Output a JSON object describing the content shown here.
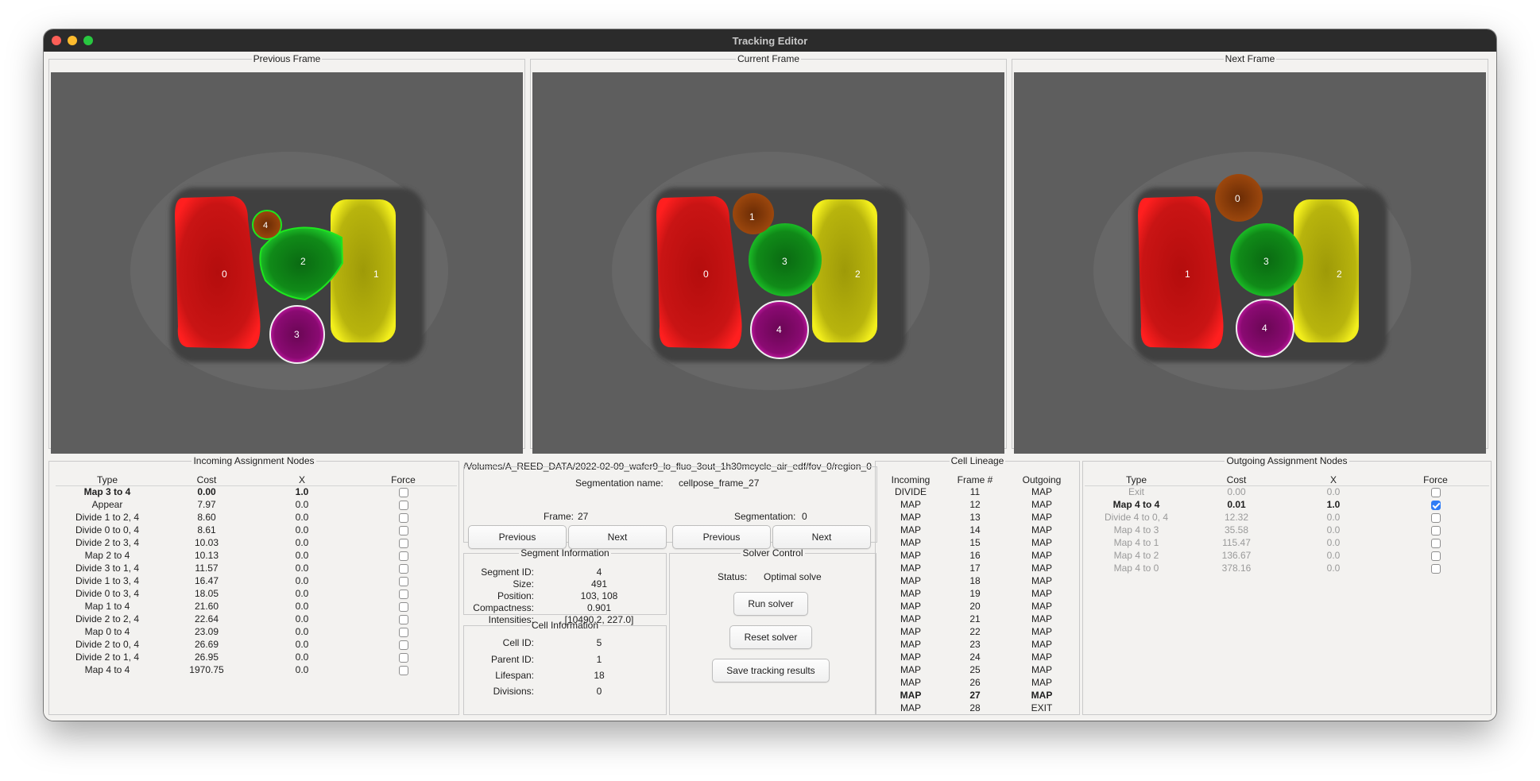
{
  "window": {
    "title": "Tracking Editor"
  },
  "frames": {
    "previous": {
      "title": "Previous Frame",
      "labels": [
        "0",
        "1",
        "2",
        "3",
        "4"
      ]
    },
    "current": {
      "title": "Current Frame",
      "labels": [
        "0",
        "1",
        "2",
        "3",
        "4"
      ]
    },
    "next": {
      "title": "Next Frame",
      "labels": [
        "0",
        "1",
        "2",
        "3",
        "4"
      ]
    }
  },
  "incoming": {
    "title": "Incoming Assignment Nodes",
    "headers": [
      "Type",
      "Cost",
      "X",
      "Force"
    ],
    "rows": [
      {
        "type": "Map 3 to 4",
        "cost": "0.00",
        "x": "1.0"
      },
      {
        "type": "Appear",
        "cost": "7.97",
        "x": "0.0"
      },
      {
        "type": "Divide 1 to 2, 4",
        "cost": "8.60",
        "x": "0.0"
      },
      {
        "type": "Divide 0 to 0, 4",
        "cost": "8.61",
        "x": "0.0"
      },
      {
        "type": "Divide 2 to 3, 4",
        "cost": "10.03",
        "x": "0.0"
      },
      {
        "type": "Map 2 to 4",
        "cost": "10.13",
        "x": "0.0"
      },
      {
        "type": "Divide 3 to 1, 4",
        "cost": "11.57",
        "x": "0.0"
      },
      {
        "type": "Divide 1 to 3, 4",
        "cost": "16.47",
        "x": "0.0"
      },
      {
        "type": "Divide 0 to 3, 4",
        "cost": "18.05",
        "x": "0.0"
      },
      {
        "type": "Map 1 to 4",
        "cost": "21.60",
        "x": "0.0"
      },
      {
        "type": "Divide 2 to 2, 4",
        "cost": "22.64",
        "x": "0.0"
      },
      {
        "type": "Map 0 to 4",
        "cost": "23.09",
        "x": "0.0"
      },
      {
        "type": "Divide 2 to 0, 4",
        "cost": "26.69",
        "x": "0.0"
      },
      {
        "type": "Divide 2 to 1, 4",
        "cost": "26.95",
        "x": "0.0"
      },
      {
        "type": "Map 4 to 4",
        "cost": "1970.75",
        "x": "0.0"
      }
    ]
  },
  "file": {
    "path": "/Volumes/A_REED_DATA/2022-02-09_wafer9_lo_fluo_3out_1h30mcycle_air_edf/fov_0/region_0",
    "seg_name_label": "Segmentation name:",
    "seg_name": "cellpose_frame_27",
    "frame_label": "Frame:",
    "frame": "27",
    "segmentation_label": "Segmentation:",
    "segmentation": "0",
    "prev_frame": "Previous",
    "next_frame": "Next",
    "prev_seg": "Previous",
    "next_seg": "Next"
  },
  "segment_info": {
    "title": "Segment Information",
    "rows": [
      {
        "label": "Segment ID:",
        "value": "4"
      },
      {
        "label": "Size:",
        "value": "491"
      },
      {
        "label": "Position:",
        "value": "103, 108"
      },
      {
        "label": "Compactness:",
        "value": "0.901"
      },
      {
        "label": "Intensities:",
        "value": "[10490.2, 227.0]"
      }
    ]
  },
  "cell_info": {
    "title": "Cell Information",
    "rows": [
      {
        "label": "Cell ID:",
        "value": "5"
      },
      {
        "label": "Parent ID:",
        "value": "1"
      },
      {
        "label": "Lifespan:",
        "value": "18"
      },
      {
        "label": "Divisions:",
        "value": "0"
      }
    ]
  },
  "solver": {
    "title": "Solver Control",
    "status_label": "Status:",
    "status": "Optimal solve",
    "run": "Run solver",
    "reset": "Reset solver",
    "save": "Save tracking results"
  },
  "lineage": {
    "title": "Cell Lineage",
    "headers": [
      "Incoming",
      "Frame #",
      "Outgoing"
    ],
    "rows": [
      {
        "in": "DIVIDE",
        "frame": "11",
        "out": "MAP"
      },
      {
        "in": "MAP",
        "frame": "12",
        "out": "MAP"
      },
      {
        "in": "MAP",
        "frame": "13",
        "out": "MAP"
      },
      {
        "in": "MAP",
        "frame": "14",
        "out": "MAP"
      },
      {
        "in": "MAP",
        "frame": "15",
        "out": "MAP"
      },
      {
        "in": "MAP",
        "frame": "16",
        "out": "MAP"
      },
      {
        "in": "MAP",
        "frame": "17",
        "out": "MAP"
      },
      {
        "in": "MAP",
        "frame": "18",
        "out": "MAP"
      },
      {
        "in": "MAP",
        "frame": "19",
        "out": "MAP"
      },
      {
        "in": "MAP",
        "frame": "20",
        "out": "MAP"
      },
      {
        "in": "MAP",
        "frame": "21",
        "out": "MAP"
      },
      {
        "in": "MAP",
        "frame": "22",
        "out": "MAP"
      },
      {
        "in": "MAP",
        "frame": "23",
        "out": "MAP"
      },
      {
        "in": "MAP",
        "frame": "24",
        "out": "MAP"
      },
      {
        "in": "MAP",
        "frame": "25",
        "out": "MAP"
      },
      {
        "in": "MAP",
        "frame": "26",
        "out": "MAP"
      },
      {
        "in": "MAP",
        "frame": "27",
        "out": "MAP"
      },
      {
        "in": "MAP",
        "frame": "28",
        "out": "EXIT"
      }
    ]
  },
  "outgoing": {
    "title": "Outgoing Assignment Nodes",
    "headers": [
      "Type",
      "Cost",
      "X",
      "Force"
    ],
    "rows": [
      {
        "type": "Exit",
        "cost": "0.00",
        "x": "0.0"
      },
      {
        "type": "Map 4 to 4",
        "cost": "0.01",
        "x": "1.0"
      },
      {
        "type": "Divide 4 to 0, 4",
        "cost": "12.32",
        "x": "0.0"
      },
      {
        "type": "Map 4 to 3",
        "cost": "35.58",
        "x": "0.0"
      },
      {
        "type": "Map 4 to 1",
        "cost": "115.47",
        "x": "0.0"
      },
      {
        "type": "Map 4 to 2",
        "cost": "136.67",
        "x": "0.0"
      },
      {
        "type": "Map 4 to 0",
        "cost": "378.16",
        "x": "0.0"
      }
    ]
  }
}
